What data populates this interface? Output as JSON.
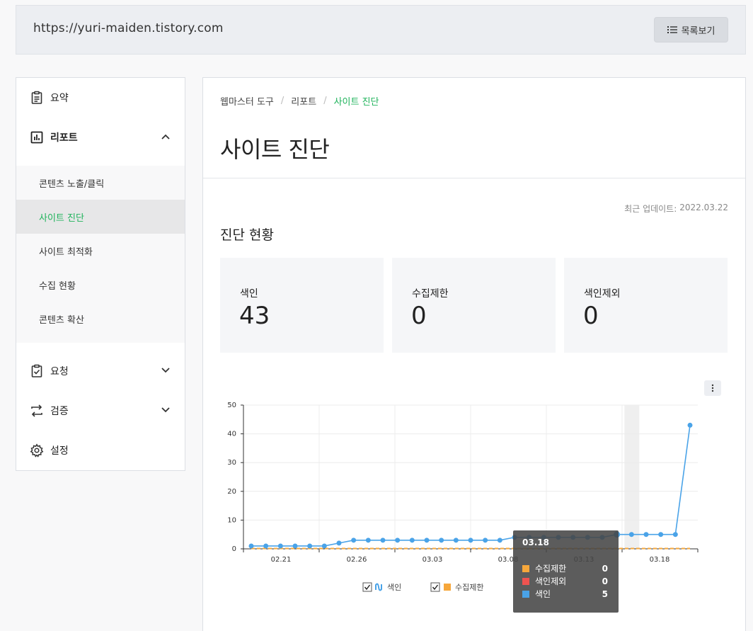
{
  "header": {
    "url": "https://yuri-maiden.tistory.com",
    "list_button": "목록보기"
  },
  "sidebar": {
    "items": [
      {
        "label": "요약"
      },
      {
        "label": "리포트"
      },
      {
        "label": "요청"
      },
      {
        "label": "검증"
      },
      {
        "label": "설정"
      }
    ],
    "sub_items": [
      {
        "label": "콘텐츠 노출/클릭"
      },
      {
        "label": "사이트 진단"
      },
      {
        "label": "사이트 최적화"
      },
      {
        "label": "수집 현황"
      },
      {
        "label": "콘텐츠 확산"
      }
    ]
  },
  "breadcrumb": [
    "웹마스터 도구",
    "리포트",
    "사이트 진단"
  ],
  "page_title": "사이트 진단",
  "last_update": {
    "label": "최근 업데이트:",
    "date": "2022.03.22"
  },
  "section_title": "진단 현황",
  "stats": [
    {
      "label": "색인",
      "value": "43"
    },
    {
      "label": "수집제한",
      "value": "0"
    },
    {
      "label": "색인제외",
      "value": "0"
    }
  ],
  "chart_data": {
    "type": "line",
    "ylim": [
      0,
      50
    ],
    "y_ticks": [
      "0",
      "10",
      "20",
      "30",
      "40",
      "50"
    ],
    "x_tick_labels": [
      "02.21",
      "02.26",
      "03.03",
      "03.08",
      "03.13",
      "03.18"
    ],
    "x": [
      "02.17",
      "02.18",
      "02.19",
      "02.20",
      "02.21",
      "02.22",
      "02.23",
      "02.24",
      "02.25",
      "02.26",
      "02.27",
      "02.28",
      "03.01",
      "03.02",
      "03.03",
      "03.04",
      "03.05",
      "03.06",
      "03.07",
      "03.08",
      "03.09",
      "03.10",
      "03.11",
      "03.12",
      "03.13",
      "03.14",
      "03.15",
      "03.16",
      "03.17",
      "03.18",
      "03.19"
    ],
    "series": [
      {
        "name": "색인",
        "color": "#4aa3e8",
        "values": [
          1,
          1,
          1,
          1,
          1,
          1,
          2,
          3,
          3,
          3,
          3,
          3,
          3,
          3,
          3,
          3,
          3,
          3,
          4,
          4,
          4,
          4,
          4,
          4,
          4,
          5,
          5,
          5,
          5,
          5,
          43
        ]
      },
      {
        "name": "수집제한",
        "color": "#f6a73b",
        "values": [
          0,
          0,
          0,
          0,
          0,
          0,
          0,
          0,
          0,
          0,
          0,
          0,
          0,
          0,
          0,
          0,
          0,
          0,
          0,
          0,
          0,
          0,
          0,
          0,
          0,
          0,
          0,
          0,
          0,
          0,
          0
        ]
      },
      {
        "name": "색인제외",
        "color": "#ef5350",
        "values": [
          0,
          0,
          0,
          0,
          0,
          0,
          0,
          0,
          0,
          0,
          0,
          0,
          0,
          0,
          0,
          0,
          0,
          0,
          0,
          0,
          0,
          0,
          0,
          0,
          0,
          0,
          0,
          0,
          0,
          0,
          0
        ]
      }
    ],
    "tooltip": {
      "date": "03.18",
      "rows": [
        {
          "name": "수집제한",
          "value": "0",
          "color": "#f6a73b"
        },
        {
          "name": "색인제외",
          "value": "0",
          "color": "#ef5350"
        },
        {
          "name": "색인",
          "value": "5",
          "color": "#4aa3e8"
        }
      ]
    },
    "legend": [
      "색인",
      "수집제한"
    ]
  }
}
